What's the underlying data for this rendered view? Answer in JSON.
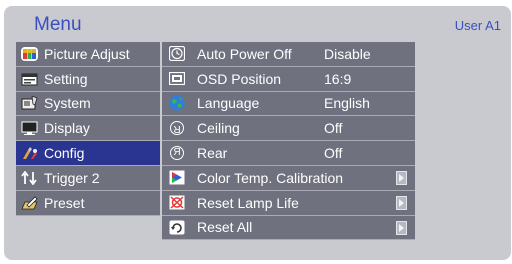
{
  "header": {
    "title": "Menu",
    "user": "User A1"
  },
  "left_menu": [
    {
      "label": "Picture Adjust",
      "icon": "picture-adjust-icon"
    },
    {
      "label": "Setting",
      "icon": "setting-icon"
    },
    {
      "label": "System",
      "icon": "system-icon"
    },
    {
      "label": "Display",
      "icon": "display-icon"
    },
    {
      "label": "Config",
      "icon": "config-icon",
      "selected": true
    },
    {
      "label": "Trigger 2",
      "icon": "trigger-icon"
    },
    {
      "label": "Preset",
      "icon": "preset-icon"
    }
  ],
  "right_menu": [
    {
      "label": "Auto Power Off",
      "value": "Disable",
      "icon": "clock-icon"
    },
    {
      "label": "OSD Position",
      "value": "16:9",
      "icon": "osd-position-icon"
    },
    {
      "label": "Language",
      "value": "English",
      "icon": "globe-icon"
    },
    {
      "label": "Ceiling",
      "value": "Off",
      "icon": "ceiling-icon"
    },
    {
      "label": "Rear",
      "value": "Off",
      "icon": "rear-icon"
    },
    {
      "label": "Color Temp. Calibration",
      "value": "",
      "icon": "color-calibration-icon",
      "submenu": true
    },
    {
      "label": "Reset Lamp Life",
      "value": "",
      "icon": "reset-lamp-icon",
      "submenu": true
    },
    {
      "label": "Reset All",
      "value": "",
      "icon": "reset-all-icon",
      "submenu": true
    }
  ],
  "colors": {
    "accent": "#3a4fc0",
    "selected": "#2a3591",
    "item_bg": "#6f717f",
    "panel_bg": "#c9cacf"
  }
}
